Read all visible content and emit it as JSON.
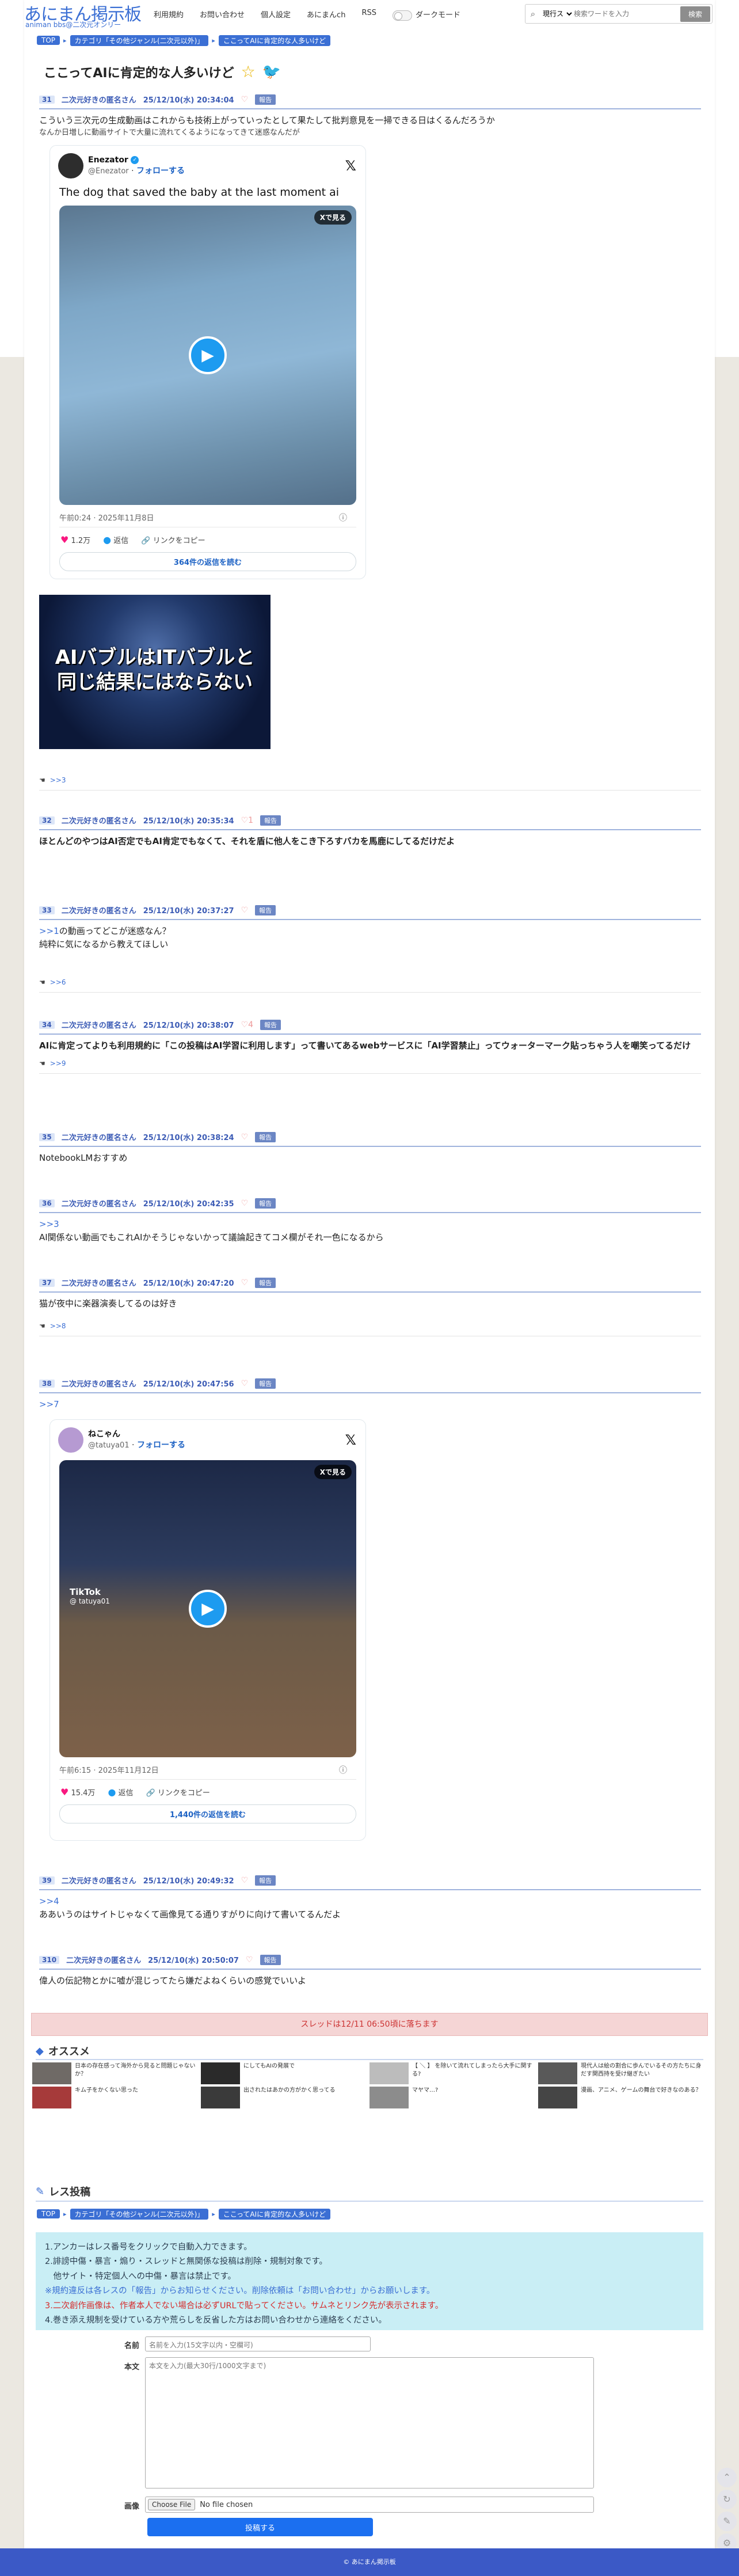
{
  "site": {
    "title": "あにまん掲示板",
    "subtitle": "animan bbs@二次元オンリー"
  },
  "nav": [
    {
      "label": "利用規約"
    },
    {
      "label": "お問い合わせ"
    },
    {
      "label": "個人設定"
    },
    {
      "label": "あにまんch"
    },
    {
      "label": "RSS"
    },
    {
      "label": "ダークモード"
    }
  ],
  "search": {
    "scope": "現行スレ",
    "placeholder": "検索ワードを入力",
    "button": "検索"
  },
  "breadcrumb": [
    "TOP",
    "カテゴリ「その他ジャンル(二次元以外)」",
    "ここってAIに肯定的な人多いけど"
  ],
  "thread": {
    "title": "ここってAIに肯定的な人多いけど"
  },
  "posts": [
    {
      "num": "31",
      "name": "二次元好きの匿名さん",
      "date": "25/12/10(水) 20:34:04",
      "likes": "",
      "report": "報告",
      "body": "こういう三次元の生成動画はこれからも技術上がっていったとして果たして批判意見を一掃できる日はくるんだろうか",
      "body2": "なんか日増しに動画サイトで大量に流れてくるようになってきて迷惑なんだが",
      "replies": ">>3"
    },
    {
      "num": "32",
      "name": "二次元好きの匿名さん",
      "date": "25/12/10(水) 20:35:34",
      "likes": "1",
      "report": "報告",
      "body": "ほとんどのやつはAI否定でもAI肯定でもなくて、それを盾に他人をこき下ろすバカを馬鹿にしてるだけだよ"
    },
    {
      "num": "33",
      "name": "二次元好きの匿名さん",
      "date": "25/12/10(水) 20:37:27",
      "likes": "",
      "report": "報告",
      "anchor": ">>1",
      "body": "の動画ってどこが迷惑なん？",
      "body2": "純粋に気になるから教えてほしい",
      "replies": ">>6"
    },
    {
      "num": "34",
      "name": "二次元好きの匿名さん",
      "date": "25/12/10(水) 20:38:07",
      "likes": "4",
      "report": "報告",
      "body": "AIに肯定ってよりも利用規約に「この投稿はAI学習に利用します」って書いてあるwebサービスに「AI学習禁止」ってウォーターマーク貼っちゃう人を嘲笑ってるだけ",
      "replies": ">>9"
    },
    {
      "num": "35",
      "name": "二次元好きの匿名さん",
      "date": "25/12/10(水) 20:38:24",
      "likes": "",
      "report": "報告",
      "body": "NotebookLMおすすめ"
    },
    {
      "num": "36",
      "name": "二次元好きの匿名さん",
      "date": "25/12/10(水) 20:42:35",
      "likes": "",
      "report": "報告",
      "anchor": ">>3",
      "body2": "AI関係ない動画でもこれAIかそうじゃないかって議論起きてコメ欄がそれ一色になるから"
    },
    {
      "num": "37",
      "name": "二次元好きの匿名さん",
      "date": "25/12/10(水) 20:47:20",
      "likes": "",
      "report": "報告",
      "body": "猫が夜中に楽器演奏してるのは好き",
      "replies": ">>8"
    },
    {
      "num": "38",
      "name": "二次元好きの匿名さん",
      "date": "25/12/10(水) 20:47:56",
      "likes": "",
      "report": "報告",
      "anchor": ">>7"
    },
    {
      "num": "39",
      "name": "二次元好きの匿名さん",
      "date": "25/12/10(水) 20:49:32",
      "likes": "",
      "report": "報告",
      "anchor": ">>4",
      "body2": "ああいうのはサイトじゃなくて画像見てる通りすがりに向けて書いてるんだよ"
    },
    {
      "num": "310",
      "name": "二次元好きの匿名さん",
      "date": "25/12/10(水) 20:50:07",
      "likes": "",
      "report": "報告",
      "body": "偉人の伝記物とかに嘘が混じってたら嫌だよねくらいの感覚でいいよ"
    }
  ],
  "embed1": {
    "name": "Enezator",
    "handle": "@Enezator",
    "follow": "フォローする",
    "x_logo": "𝕏",
    "text": "The dog that saved the baby at the last moment ai",
    "view_on_x": "Xで見る",
    "time": "午前0:24 · 2025年11月8日",
    "likes": "1.2万",
    "reply": "返信",
    "copy": "リンクをコピー",
    "more": "364件の返信を読む"
  },
  "embed2": {
    "name": "ねこゃん",
    "handle": "@tatuya01",
    "follow": "フォローする",
    "x_logo": "𝕏",
    "view_on_x": "Xで見る",
    "tiktok": "TikTok",
    "tiktok_user": "@ tatuya01",
    "time": "午前6:15 · 2025年11月12日",
    "likes": "15.4万",
    "reply": "返信",
    "copy": "リンクをコピー",
    "more": "1,440件の返信を読む"
  },
  "ai_image": {
    "caption_line1": "AIバブルはITバブルと",
    "caption_line2": "同じ結果にはならない"
  },
  "expire_notice": "スレッドは12/11 06:50頃に落ちます",
  "recommend": {
    "title": "オススメ",
    "items": [
      {
        "text": "日本の存在感って海外から見ると問題じゃないか？",
        "color": "#6f6a66"
      },
      {
        "text": "にしてもAIの発展で",
        "color": "#2a2a2a"
      },
      {
        "text": "【 ＼ 】 を除いて流れてしまったら大手に関する?",
        "color": "#bcbcbc"
      },
      {
        "text": "現代人は絵の割合に歩んでいるその方たちに身だす関西持を受け継ぎたい",
        "color": "#595959"
      },
      {
        "text": "キム子をかくない思った",
        "color": "#a63a3a"
      },
      {
        "text": "出されたはあかの方がかく思ってる",
        "color": "#3a3a3a"
      },
      {
        "text": "マヤマ…?",
        "color": "#8c8c8c"
      },
      {
        "text": "漫画、アニメ、ゲームの舞台で好きなのある？",
        "color": "#454545"
      }
    ]
  },
  "reply_form": {
    "title": "レス投稿",
    "rules": [
      "1.アンカーはレス番号をクリックで自動入力できます。",
      "2.誹謗中傷・暴言・煽り・スレッドと無関係な投稿は削除・規制対象です。",
      "　他サイト・特定個人への中傷・暴言は禁止です。",
      "※規約違反は各レスの「報告」からお知らせください。削除依頼は「お問い合わせ」からお願いします。",
      "3.二次創作画像は、作者本人でない場合は必ずURLで貼ってください。サムネとリンク先が表示されます。",
      "4.巻き添え規制を受けている方や荒らしを反省した方はお問い合わせから連絡をください。"
    ],
    "name_label": "名前",
    "name_placeholder": "名前を入力(15文字以内・空欄可)",
    "body_label": "本文",
    "body_placeholder": "本文を入力(最大30行/1000文字まで)",
    "image_label": "画像",
    "file_button": "Choose File",
    "file_status": "No file chosen",
    "submit": "投稿する"
  },
  "footer": {
    "text": "© あにまん掲示板"
  }
}
